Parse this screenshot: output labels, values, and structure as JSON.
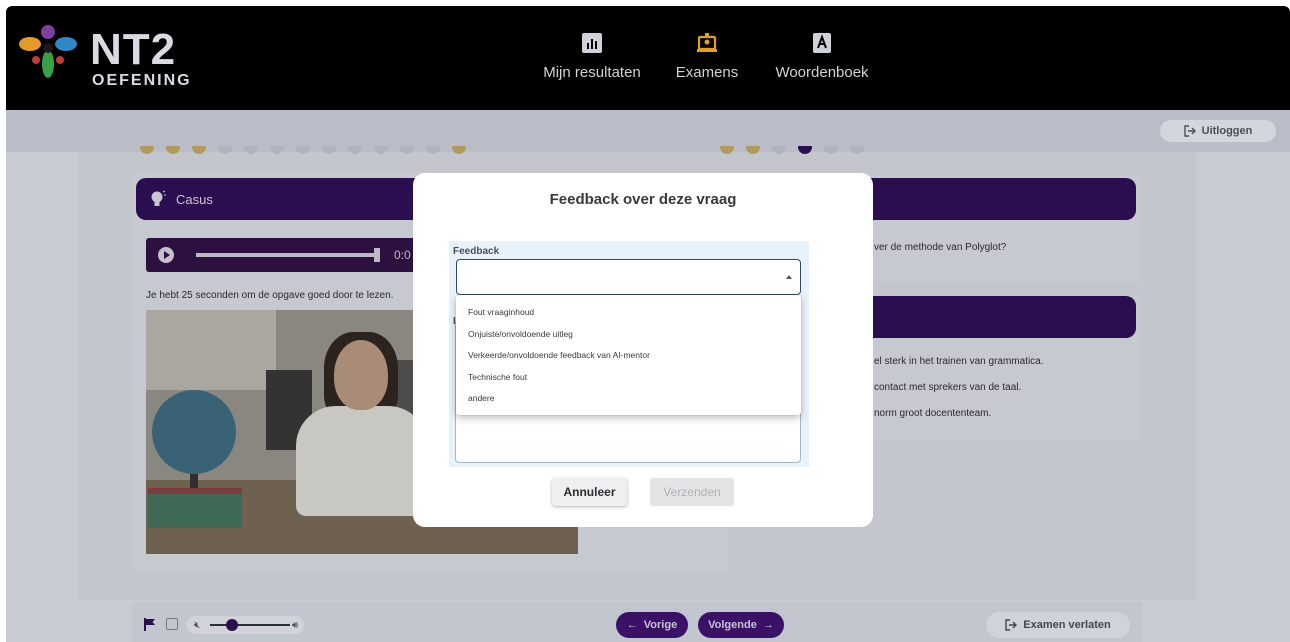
{
  "app": {
    "logo_title": "NT2",
    "logo_subtitle": "OEFENING"
  },
  "nav": {
    "results_label": "Mijn resultaten",
    "exams_label": "Examens",
    "dictionary_label": "Woordenboek"
  },
  "header": {
    "logout_label": "Uitloggen"
  },
  "casus": {
    "title": "Casus",
    "audio_time": "0:0",
    "read_note": "Je hebt 25 seconden om de opgave goed door te lezen."
  },
  "question": {
    "text_fragment": "ver de methode van Polyglot?",
    "options": [
      "el sterk in het trainen van grammatica.",
      "contact met sprekers van de taal.",
      "norm groot docententeam."
    ]
  },
  "footer": {
    "prev_label": "Vorige",
    "next_label": "Volgende",
    "exit_label": "Examen verlaten",
    "volume_level": 0.2
  },
  "modal": {
    "title": "Feedback over deze vraag",
    "feedback_label": "Feedback",
    "feedback_value": "",
    "second_label_peek": "L",
    "dropdown_options": [
      "Fout vraaginhoud",
      "Onjuiste/onvoldoende uitleg",
      "Verkeerde/onvoldoende feedback van AI-mentor",
      "Technische fout",
      "andere"
    ],
    "cancel_label": "Annuleer",
    "submit_label": "Verzenden"
  },
  "colors": {
    "brand_purple": "#3a1166",
    "header_bg": "#000000",
    "overlay": "#c9ccd3"
  }
}
